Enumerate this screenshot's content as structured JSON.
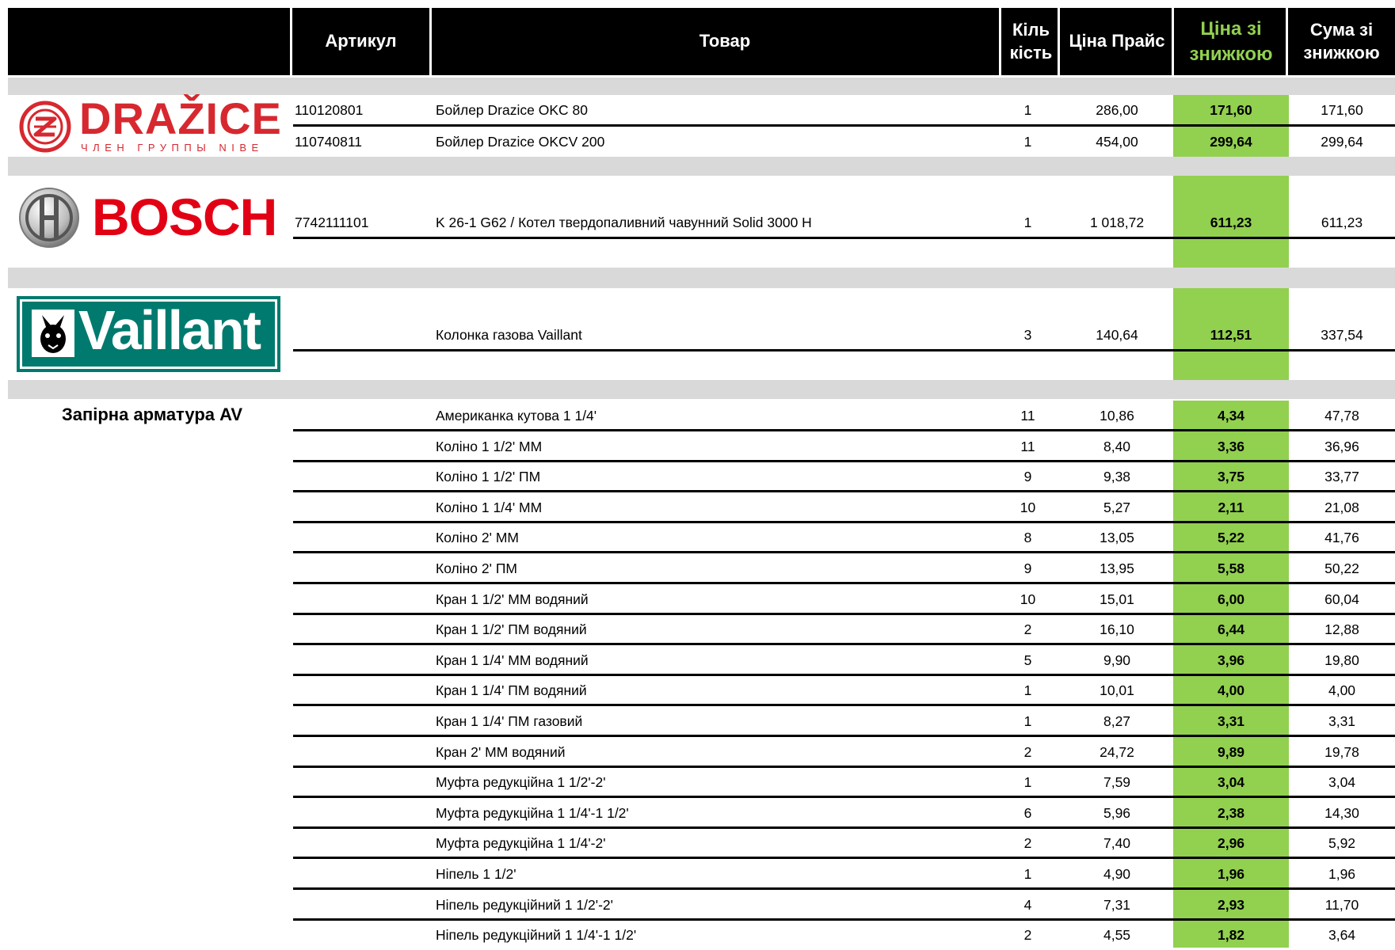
{
  "header": {
    "article": "Артикул",
    "product": "Товар",
    "qty_line1": "Кіль",
    "qty_line2": "кість",
    "price": "Ціна Прайс",
    "disc_line1": "Ціна зі",
    "disc_line2": "знижкою",
    "sum_line1": "Сума зі",
    "sum_line2": "знижкою"
  },
  "colors": {
    "header_bg": "#000000",
    "discount_title": "#92d050",
    "discount_cell": "#92d050",
    "band": "#d9d9d9",
    "drazice": "#d7282f",
    "bosch": "#e20015",
    "vaillant": "#007a6e"
  },
  "brands": {
    "drazice": {
      "name": "DRAŽICE",
      "tagline": "ЧЛЕН ГРУППЫ NIBE"
    },
    "bosch": {
      "name": "BOSCH"
    },
    "vaillant": {
      "name": "Vaillant"
    }
  },
  "groups": {
    "drazice_rows": [
      {
        "article": "110120801",
        "name": "Бойлер Drazice OKC 80",
        "qty": "1",
        "price": "286,00",
        "discount": "171,60",
        "sum": "171,60"
      },
      {
        "article": "110740811",
        "name": "Бойлер Drazice OKCV 200",
        "qty": "1",
        "price": "454,00",
        "discount": "299,64",
        "sum": "299,64"
      }
    ],
    "bosch_row": {
      "article": "7742111101",
      "name": "K 26-1 G62 / Котел твердопаливний чавунний Solid 3000 H",
      "qty": "1",
      "price": "1 018,72",
      "discount": "611,23",
      "sum": "611,23"
    },
    "vaillant_row": {
      "article": "",
      "name": "Колонка газова Vaillant",
      "qty": "3",
      "price": "140,64",
      "discount": "112,51",
      "sum": "337,54"
    },
    "av_title": "Запірна арматура AV",
    "av_rows": [
      {
        "name": "Американка кутова 1 1/4'",
        "qty": "11",
        "price": "10,86",
        "discount": "4,34",
        "sum": "47,78"
      },
      {
        "name": "Коліно 1 1/2' ММ",
        "qty": "11",
        "price": "8,40",
        "discount": "3,36",
        "sum": "36,96"
      },
      {
        "name": "Коліно 1 1/2' ПМ",
        "qty": "9",
        "price": "9,38",
        "discount": "3,75",
        "sum": "33,77"
      },
      {
        "name": "Коліно 1 1/4' ММ",
        "qty": "10",
        "price": "5,27",
        "discount": "2,11",
        "sum": "21,08"
      },
      {
        "name": "Коліно 2' ММ",
        "qty": "8",
        "price": "13,05",
        "discount": "5,22",
        "sum": "41,76"
      },
      {
        "name": "Коліно 2' ПМ",
        "qty": "9",
        "price": "13,95",
        "discount": "5,58",
        "sum": "50,22"
      },
      {
        "name": "Кран 1 1/2' ММ водяний",
        "qty": "10",
        "price": "15,01",
        "discount": "6,00",
        "sum": "60,04"
      },
      {
        "name": "Кран 1 1/2' ПМ водяний",
        "qty": "2",
        "price": "16,10",
        "discount": "6,44",
        "sum": "12,88"
      },
      {
        "name": "Кран 1 1/4' ММ водяний",
        "qty": "5",
        "price": "9,90",
        "discount": "3,96",
        "sum": "19,80"
      },
      {
        "name": "Кран 1 1/4' ПМ водяний",
        "qty": "1",
        "price": "10,01",
        "discount": "4,00",
        "sum": "4,00"
      },
      {
        "name": "Кран 1 1/4' ПМ газовий",
        "qty": "1",
        "price": "8,27",
        "discount": "3,31",
        "sum": "3,31"
      },
      {
        "name": "Кран 2' ММ водяний",
        "qty": "2",
        "price": "24,72",
        "discount": "9,89",
        "sum": "19,78"
      },
      {
        "name": "Муфта редукційна 1 1/2'-2'",
        "qty": "1",
        "price": "7,59",
        "discount": "3,04",
        "sum": "3,04"
      },
      {
        "name": "Муфта редукційна 1 1/4'-1 1/2'",
        "qty": "6",
        "price": "5,96",
        "discount": "2,38",
        "sum": "14,30"
      },
      {
        "name": "Муфта редукційна 1 1/4'-2'",
        "qty": "2",
        "price": "7,40",
        "discount": "2,96",
        "sum": "5,92"
      },
      {
        "name": "Ніпель 1 1/2'",
        "qty": "1",
        "price": "4,90",
        "discount": "1,96",
        "sum": "1,96"
      },
      {
        "name": "Ніпель редукційний 1 1/2'-2'",
        "qty": "4",
        "price": "7,31",
        "discount": "2,93",
        "sum": "11,70"
      },
      {
        "name": "Ніпель редукційний 1 1/4'-1 1/2'",
        "qty": "2",
        "price": "4,55",
        "discount": "1,82",
        "sum": "3,64"
      }
    ]
  }
}
